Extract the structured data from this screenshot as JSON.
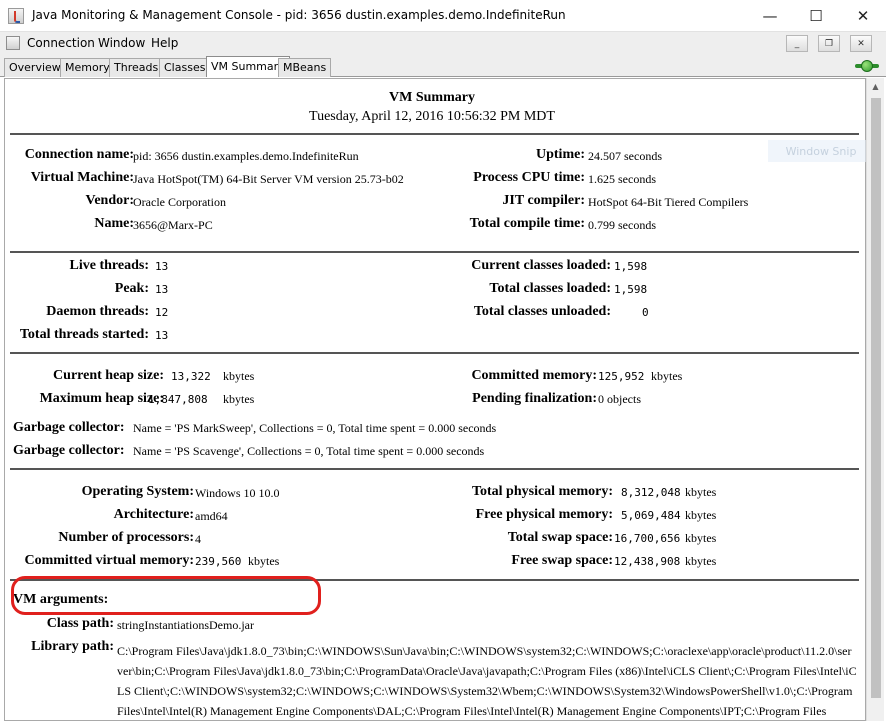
{
  "window": {
    "title": "Java Monitoring & Management Console - pid: 3656 dustin.examples.demo.IndefiniteRun",
    "minimize": "—",
    "maximize": "☐",
    "close": "✕"
  },
  "menu": {
    "items": [
      "Connection",
      "Window",
      "Help"
    ],
    "mdi": {
      "minimize": "_",
      "restore": "❐",
      "close": "✕"
    }
  },
  "tabs": {
    "items": [
      "Overview",
      "Memory",
      "Threads",
      "Classes",
      "VM Summary",
      "MBeans"
    ],
    "active": "VM Summary"
  },
  "summary": {
    "title": "VM Summary",
    "datetime": "Tuesday, April 12, 2016 10:56:32 PM MDT",
    "general": {
      "connection_name_label": "Connection name:",
      "connection_name": "pid: 3656 dustin.examples.demo.IndefiniteRun",
      "virtual_machine_label": "Virtual Machine:",
      "virtual_machine": "Java HotSpot(TM) 64-Bit Server VM version 25.73-b02",
      "vendor_label": "Vendor:",
      "vendor": "Oracle Corporation",
      "name_label": "Name:",
      "name": "3656@Marx-PC",
      "uptime_label": "Uptime:",
      "uptime": "24.507 seconds",
      "process_cpu_label": "Process CPU time:",
      "process_cpu": "1.625 seconds",
      "jit_label": "JIT compiler:",
      "jit": "HotSpot 64-Bit Tiered Compilers",
      "compile_time_label": "Total compile time:",
      "compile_time": "0.799 seconds"
    },
    "threads": {
      "live_label": "Live threads:",
      "live": "13",
      "peak_label": "Peak:",
      "peak": "13",
      "daemon_label": "Daemon threads:",
      "daemon": "12",
      "started_label": "Total threads started:",
      "started": "13",
      "classes_loaded_label": "Current classes loaded:",
      "classes_loaded": "1,598",
      "total_loaded_label": "Total classes loaded:",
      "total_loaded": "1,598",
      "unloaded_label": "Total classes unloaded:",
      "unloaded": "0"
    },
    "memory": {
      "heap_label": "Current heap size:",
      "heap": "13,322",
      "max_heap_label": "Maximum heap size:",
      "max_heap": "1,847,808",
      "kbytes": "kbytes",
      "committed_label": "Committed memory:",
      "committed": "125,952",
      "pending_label": "Pending finalization:",
      "pending": "0 objects",
      "gc_label": "Garbage collector:",
      "gc1": "Name = 'PS MarkSweep', Collections = 0, Total time spent = 0.000 seconds",
      "gc2": "Name = 'PS Scavenge', Collections = 0, Total time spent = 0.000 seconds"
    },
    "os": {
      "os_label": "Operating System:",
      "os": "Windows 10 10.0",
      "arch_label": "Architecture:",
      "arch": "amd64",
      "procs_label": "Number of processors:",
      "procs": "4",
      "cvm_label": "Committed virtual memory:",
      "cvm": "239,560",
      "tpm_label": "Total physical memory:",
      "tpm": "8,312,048",
      "fpm_label": "Free physical memory:",
      "fpm": "5,069,484",
      "tss_label": "Total swap space:",
      "tss": "16,700,656",
      "fss_label": "Free swap space:",
      "fss": "12,438,908"
    },
    "vm": {
      "args_label": "VM arguments:",
      "class_path_label": "Class path:",
      "class_path": "stringInstantiationsDemo.jar",
      "library_path_label": "Library path:",
      "library_path": "C:\\Program Files\\Java\\jdk1.8.0_73\\bin;C:\\WINDOWS\\Sun\\Java\\bin;C:\\WINDOWS\\system32;C:\\WINDOWS;C:\\oraclexe\\app\\oracle\\product\\11.2.0\\server\\bin;C:\\Program Files\\Java\\jdk1.8.0_73\\bin;C:\\ProgramData\\Oracle\\Java\\javapath;C:\\Program Files (x86)\\Intel\\iCLS Client\\;C:\\Program Files\\Intel\\iCLS Client\\;C:\\WINDOWS\\system32;C:\\WINDOWS;C:\\WINDOWS\\System32\\Wbem;C:\\WINDOWS\\System32\\WindowsPowerShell\\v1.0\\;C:\\Program Files\\Intel\\Intel(R) Management Engine Components\\DAL;C:\\Program Files\\Intel\\Intel(R) Management Engine Components\\IPT;C:\\Program Files"
    }
  },
  "overlay": {
    "watermark": "Window Snip"
  },
  "colors": {
    "annotation": "#e0201d",
    "connected": "#2f9a2f"
  }
}
